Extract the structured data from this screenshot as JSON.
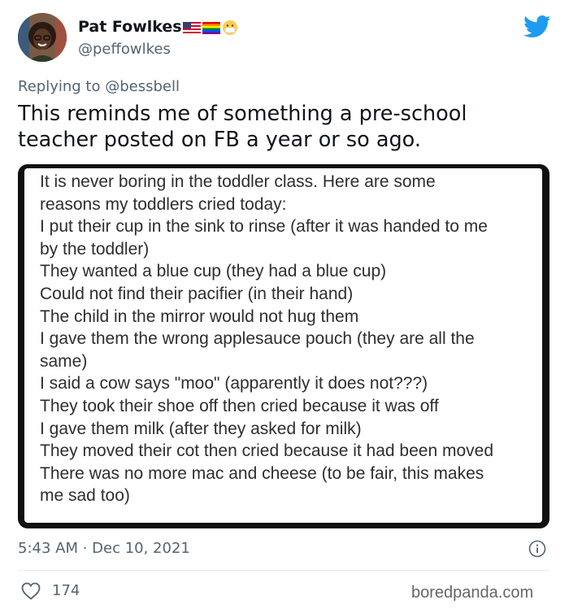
{
  "author": {
    "name": "Pat Fowlkes",
    "handle": "@peffowlkes",
    "emojis": [
      "us-flag-icon",
      "rainbow-flag-icon",
      "mask-face-icon"
    ]
  },
  "reply": {
    "prefix": "Replying to",
    "mention": "@bessbell"
  },
  "tweet": {
    "text": "This reminds me of something a pre-school teacher posted on FB a year or so ago.",
    "timestamp": "5:43 AM · Dec 10, 2021",
    "likes": "174"
  },
  "media": {
    "lines": [
      "It is never boring in the toddler class. Here are some",
      "reasons my toddlers cried today:",
      "I put their cup in the sink to rinse (after it was handed to me",
      "by the toddler)",
      "They wanted a blue cup (they had a blue cup)",
      "Could not find their pacifier (in their hand)",
      "The child in the mirror would not hug them",
      "I gave them the wrong applesauce pouch (they are all the",
      "same)",
      "I said a cow says \"moo\" (apparently it does not???)",
      "They took their shoe off then cried because it was off",
      "I gave them milk (after they asked for milk)",
      "They moved their cot then cried because it had been moved",
      "There was no more mac and cheese (to be fair, this makes",
      "me sad too)"
    ]
  },
  "watermark": "boredpanda.com",
  "colors": {
    "twitter_blue": "#1d9bf0",
    "secondary_text": "#536471",
    "primary_text": "#0f1419"
  }
}
